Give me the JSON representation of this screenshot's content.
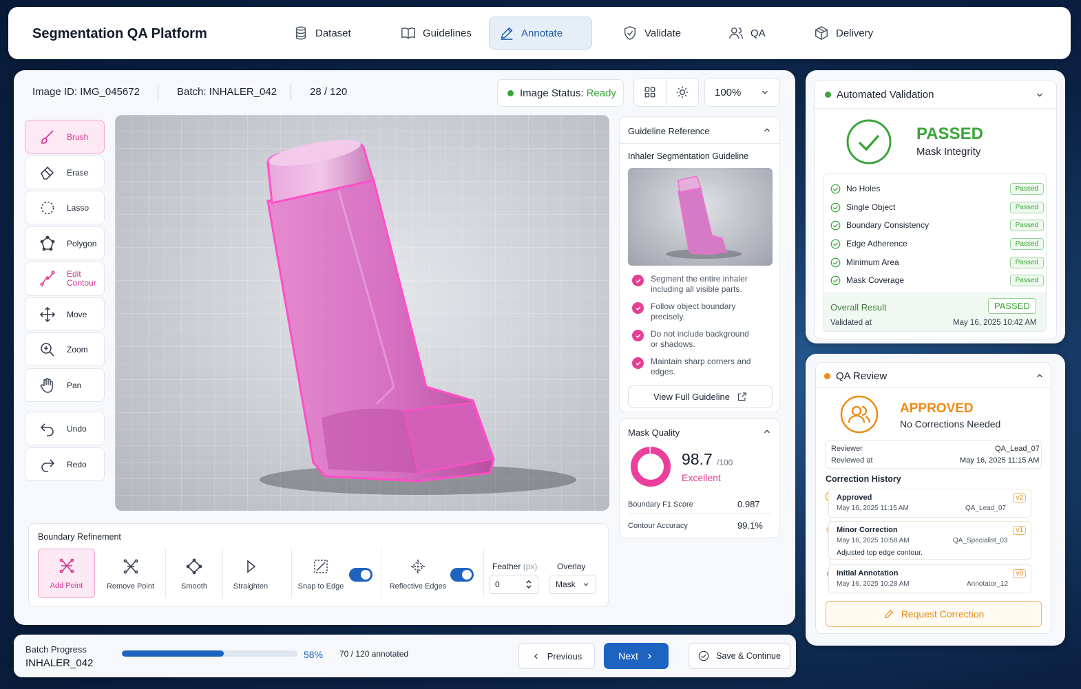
{
  "app": {
    "title": "Segmentation QA Platform"
  },
  "nav": {
    "tabs": [
      {
        "label": "Dataset",
        "icon": "database-icon"
      },
      {
        "label": "Guidelines",
        "icon": "book-icon"
      },
      {
        "label": "Annotate",
        "icon": "pencil-icon",
        "active": true
      },
      {
        "label": "Validate",
        "icon": "shield-check-icon"
      },
      {
        "label": "QA",
        "icon": "users-icon"
      },
      {
        "label": "Delivery",
        "icon": "package-icon"
      }
    ]
  },
  "image": {
    "id_text": "Image ID: IMG_045672",
    "batch_text": "Batch: INHALER_042",
    "counter": "28 / 120",
    "status_label": "Image Status:",
    "status_value": "Ready",
    "zoom": "100%"
  },
  "tools": [
    "Brush",
    "Erase",
    "Lasso",
    "Polygon",
    "Edit Contour",
    "Move",
    "Zoom",
    "Pan",
    "Undo",
    "Redo"
  ],
  "guideline": {
    "header": "Guideline Reference",
    "title": "Inhaler Segmentation Guideline",
    "rules": [
      "Segment the entire inhaler including all visible parts.",
      "Follow object boundary precisely.",
      "Do not include background or shadows.",
      "Maintain sharp corners and edges."
    ],
    "view_button": "View Full Guideline"
  },
  "mask_quality": {
    "header": "Mask Quality",
    "score": "98.7",
    "score_max": "/100",
    "score_fraction": 0.987,
    "rating": "Excellent",
    "metrics": [
      {
        "label": "Boundary F1 Score",
        "value": "0.987"
      },
      {
        "label": "Contour Accuracy",
        "value": "99.1%"
      }
    ]
  },
  "refinement": {
    "title": "Boundary Refinement",
    "tools": [
      "Add Point",
      "Remove Point",
      "Smooth",
      "Straighten"
    ],
    "snap_label": "Snap to Edge",
    "reflective_label": "Reflective Edges",
    "feather_label": "Feather",
    "feather_unit": "(px)",
    "feather_value": "0",
    "overlay_label": "Overlay",
    "overlay_value": "Mask"
  },
  "validation": {
    "header": "Automated Validation",
    "status": "PASSED",
    "subtitle": "Mask Integrity",
    "checks": [
      {
        "label": "No Holes",
        "status": "Passed"
      },
      {
        "label": "Single Object",
        "status": "Passed"
      },
      {
        "label": "Boundary Consistency",
        "status": "Passed"
      },
      {
        "label": "Edge Adherence",
        "status": "Passed"
      },
      {
        "label": "Minimum Area",
        "status": "Passed"
      },
      {
        "label": "Mask Coverage",
        "status": "Passed"
      }
    ],
    "overall_label": "Overall Result",
    "overall_value": "PASSED",
    "validated_label": "Validated at",
    "validated_value": "May 16, 2025 10:42 AM"
  },
  "qa": {
    "header": "QA Review",
    "status": "APPROVED",
    "subtitle": "No Corrections Needed",
    "reviewer_label": "Reviewer",
    "reviewer_value": "QA_Lead_07",
    "reviewed_label": "Reviewed at",
    "reviewed_value": "May 16, 2025 11:15 AM",
    "history_title": "Correction History",
    "history": [
      {
        "title": "Approved",
        "date": "May 16, 2025 11:15 AM",
        "user": "QA_Lead_07",
        "version": "v2",
        "note": ""
      },
      {
        "title": "Minor Correction",
        "date": "May 16, 2025 10:58 AM",
        "user": "QA_Specialist_03",
        "version": "v1",
        "note": "Adjusted top edge contour."
      },
      {
        "title": "Initial Annotation",
        "date": "May 16, 2025 10:28 AM",
        "user": "Annotator_12",
        "version": "v0",
        "note": ""
      }
    ],
    "request_button": "Request Correction"
  },
  "footer": {
    "label": "Batch Progress",
    "batch": "INHALER_042",
    "percent": "58%",
    "progress_fraction": 0.58,
    "count": "70 / 120 annotated",
    "prev": "Previous",
    "next": "Next",
    "save": "Save & Continue"
  },
  "colors": {
    "accent": "#1f63c0",
    "mask": "#e53e96",
    "success": "#3aa63a",
    "warning": "#f08a12"
  }
}
